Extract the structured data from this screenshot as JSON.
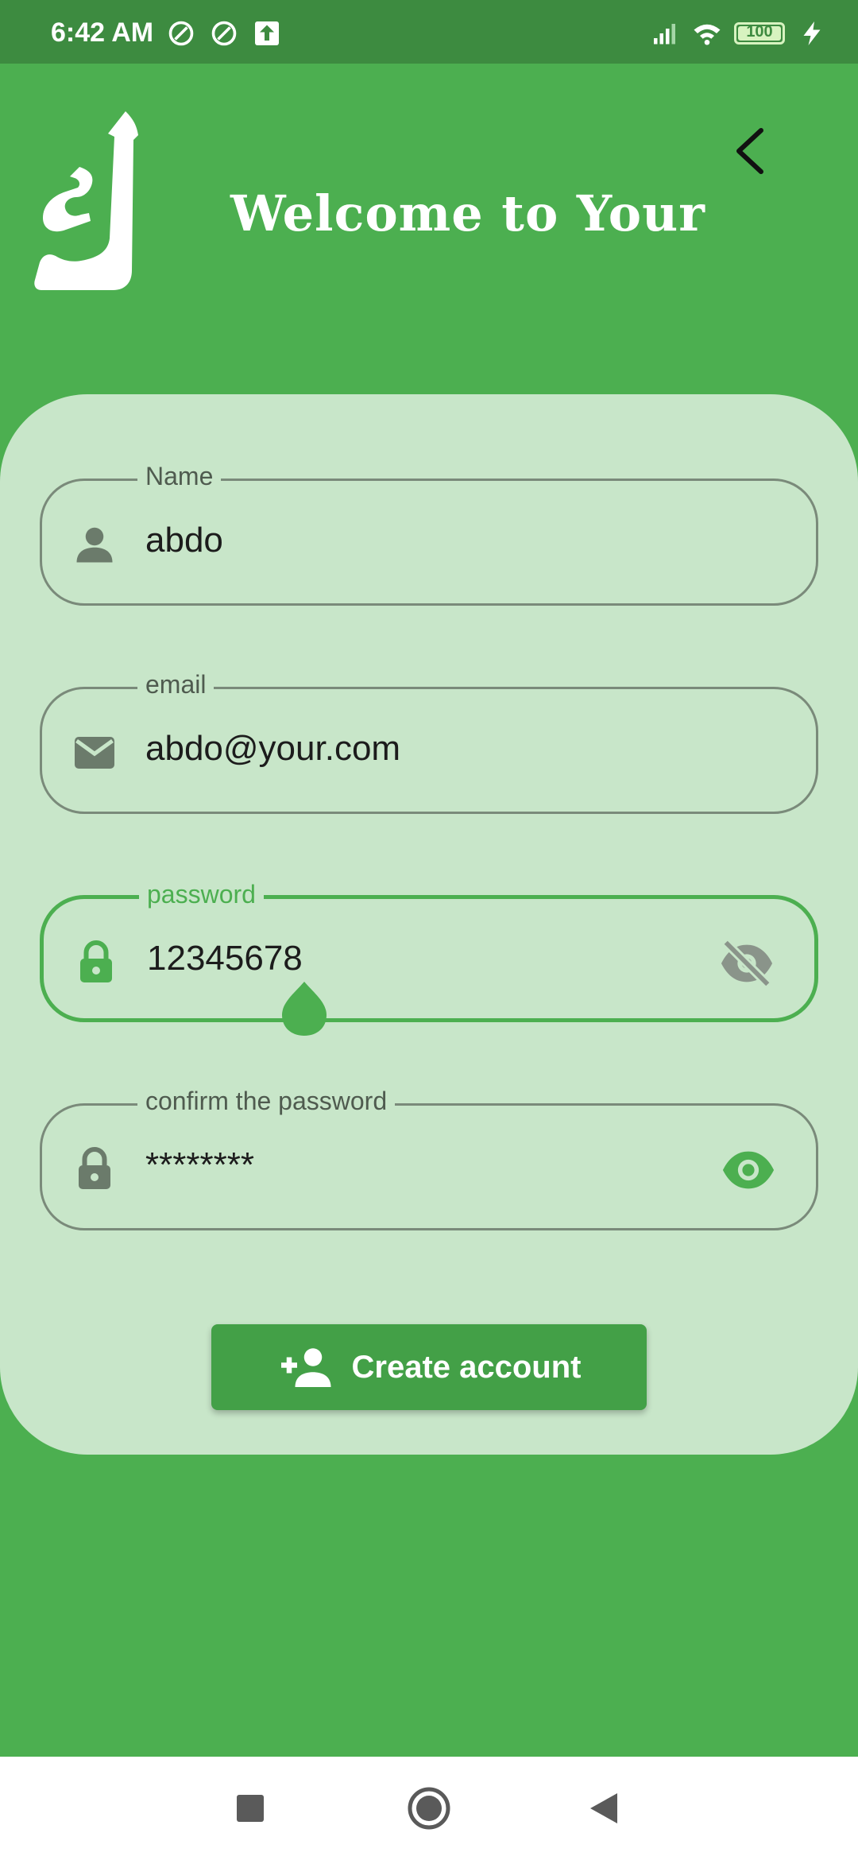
{
  "status_bar": {
    "time": "6:42 AM",
    "battery": "100",
    "icons": [
      "at-icon",
      "at-icon",
      "upload-icon",
      "signal-icon",
      "wifi-icon",
      "battery-icon",
      "charging-icon"
    ]
  },
  "header": {
    "welcome": "Welcome to Your",
    "logo_glyph": "ك"
  },
  "form": {
    "name": {
      "label": "Name",
      "value": "abdo"
    },
    "email": {
      "label": "email",
      "value": "abdo@your.com"
    },
    "password": {
      "label": "password",
      "value": "12345678"
    },
    "confirm": {
      "label": "confirm the password",
      "value": "********"
    }
  },
  "actions": {
    "create_label": "Create account"
  },
  "colors": {
    "background": "#4caf50",
    "card": "#c8e6c9",
    "status_bar": "#3d8b40",
    "accent": "#4caf50",
    "button": "#43a047"
  }
}
